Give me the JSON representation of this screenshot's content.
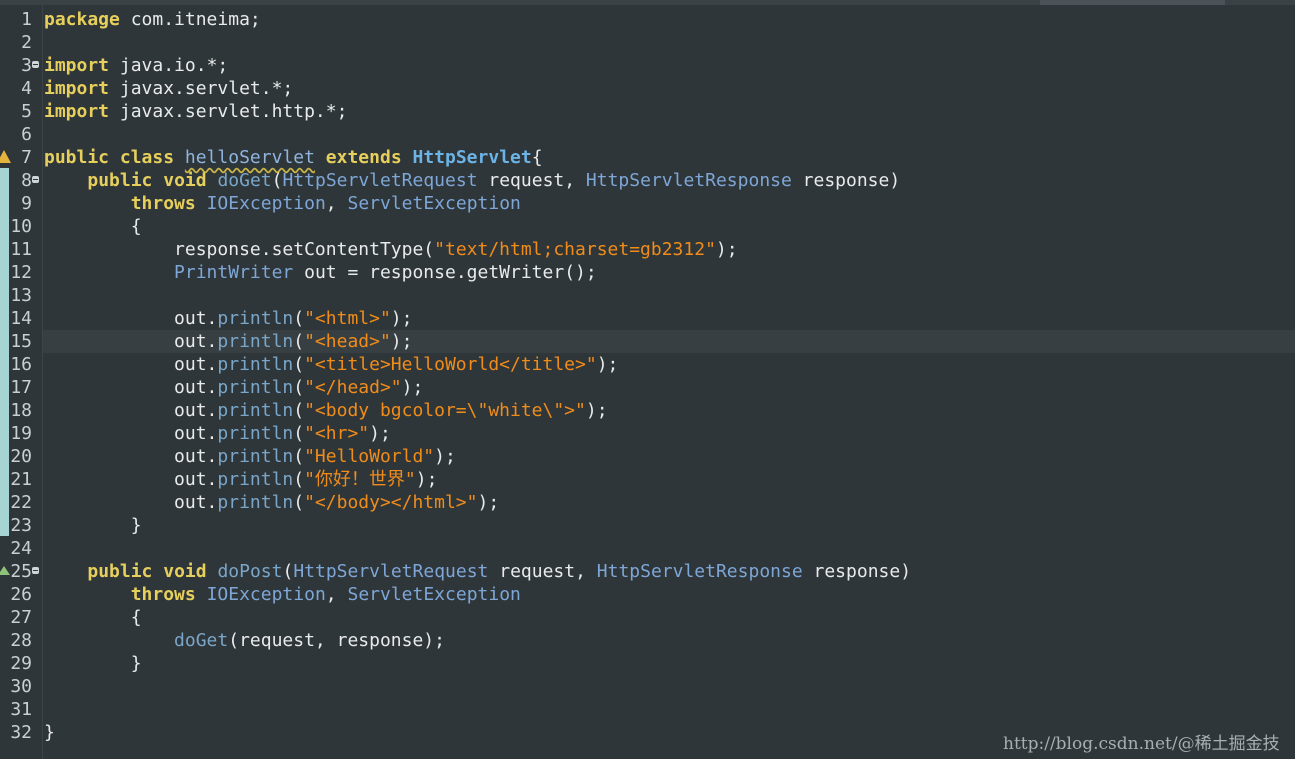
{
  "editor": {
    "language": "java",
    "lines": [
      {
        "n": "1",
        "tokens": [
          {
            "t": "package",
            "c": "kw"
          },
          {
            "t": " com.itneima;",
            "c": "pl"
          }
        ]
      },
      {
        "n": "2",
        "tokens": []
      },
      {
        "n": "3",
        "fold": true,
        "tokens": [
          {
            "t": "import",
            "c": "kw"
          },
          {
            "t": " java.io.*;",
            "c": "pl"
          }
        ]
      },
      {
        "n": "4",
        "tokens": [
          {
            "t": "import",
            "c": "kw"
          },
          {
            "t": " javax.servlet.*;",
            "c": "pl"
          }
        ]
      },
      {
        "n": "5",
        "tokens": [
          {
            "t": "import",
            "c": "kw"
          },
          {
            "t": " javax.servlet.http.*;",
            "c": "pl"
          }
        ]
      },
      {
        "n": "6",
        "tokens": []
      },
      {
        "n": "7",
        "marker": "warn",
        "tokens": [
          {
            "t": "public",
            "c": "kw"
          },
          {
            "t": " ",
            "c": "pl"
          },
          {
            "t": "class",
            "c": "kw"
          },
          {
            "t": " ",
            "c": "pl"
          },
          {
            "t": "helloServlet",
            "c": "cls"
          },
          {
            "t": " ",
            "c": "pl"
          },
          {
            "t": "extends",
            "c": "kw"
          },
          {
            "t": " ",
            "c": "pl"
          },
          {
            "t": "HttpServlet",
            "c": "tyb"
          },
          {
            "t": "{",
            "c": "pl"
          }
        ]
      },
      {
        "n": "8",
        "fold": true,
        "tokens": [
          {
            "t": "    ",
            "c": "pl"
          },
          {
            "t": "public",
            "c": "kw"
          },
          {
            "t": " ",
            "c": "pl"
          },
          {
            "t": "void",
            "c": "kw"
          },
          {
            "t": " ",
            "c": "pl"
          },
          {
            "t": "doGet",
            "c": "fn"
          },
          {
            "t": "(",
            "c": "pl"
          },
          {
            "t": "HttpServletRequest",
            "c": "ty"
          },
          {
            "t": " request, ",
            "c": "pl"
          },
          {
            "t": "HttpServletResponse",
            "c": "ty"
          },
          {
            "t": " response)",
            "c": "pl"
          }
        ]
      },
      {
        "n": "9",
        "tokens": [
          {
            "t": "        ",
            "c": "pl"
          },
          {
            "t": "throws",
            "c": "kw"
          },
          {
            "t": " ",
            "c": "pl"
          },
          {
            "t": "IOException",
            "c": "ty"
          },
          {
            "t": ", ",
            "c": "pl"
          },
          {
            "t": "ServletException",
            "c": "ty"
          }
        ]
      },
      {
        "n": "10",
        "tokens": [
          {
            "t": "        {",
            "c": "pl"
          }
        ]
      },
      {
        "n": "11",
        "tokens": [
          {
            "t": "            response.setContentType(",
            "c": "pl"
          },
          {
            "t": "\"text/html;charset=gb2312\"",
            "c": "str"
          },
          {
            "t": ");",
            "c": "pl"
          }
        ]
      },
      {
        "n": "12",
        "tokens": [
          {
            "t": "            ",
            "c": "pl"
          },
          {
            "t": "PrintWriter",
            "c": "ty"
          },
          {
            "t": " out = response.getWriter();",
            "c": "pl"
          }
        ]
      },
      {
        "n": "13",
        "tokens": []
      },
      {
        "n": "14",
        "tokens": [
          {
            "t": "            out.",
            "c": "pl"
          },
          {
            "t": "println",
            "c": "fn"
          },
          {
            "t": "(",
            "c": "pl"
          },
          {
            "t": "\"<html>\"",
            "c": "str"
          },
          {
            "t": ");",
            "c": "pl"
          }
        ]
      },
      {
        "n": "15",
        "current": true,
        "tokens": [
          {
            "t": "            out.",
            "c": "pl"
          },
          {
            "t": "println",
            "c": "fn"
          },
          {
            "t": "(",
            "c": "pl"
          },
          {
            "t": "\"<head>\"",
            "c": "str"
          },
          {
            "t": ");",
            "c": "pl"
          }
        ]
      },
      {
        "n": "16",
        "tokens": [
          {
            "t": "            out.",
            "c": "pl"
          },
          {
            "t": "println",
            "c": "fn"
          },
          {
            "t": "(",
            "c": "pl"
          },
          {
            "t": "\"<title>HelloWorld</title>\"",
            "c": "str"
          },
          {
            "t": ");",
            "c": "pl"
          }
        ]
      },
      {
        "n": "17",
        "tokens": [
          {
            "t": "            out.",
            "c": "pl"
          },
          {
            "t": "println",
            "c": "fn"
          },
          {
            "t": "(",
            "c": "pl"
          },
          {
            "t": "\"</head>\"",
            "c": "str"
          },
          {
            "t": ");",
            "c": "pl"
          }
        ]
      },
      {
        "n": "18",
        "tokens": [
          {
            "t": "            out.",
            "c": "pl"
          },
          {
            "t": "println",
            "c": "fn"
          },
          {
            "t": "(",
            "c": "pl"
          },
          {
            "t": "\"<body bgcolor=\\\"white\\\">\"",
            "c": "str"
          },
          {
            "t": ");",
            "c": "pl"
          }
        ]
      },
      {
        "n": "19",
        "tokens": [
          {
            "t": "            out.",
            "c": "pl"
          },
          {
            "t": "println",
            "c": "fn"
          },
          {
            "t": "(",
            "c": "pl"
          },
          {
            "t": "\"<hr>\"",
            "c": "str"
          },
          {
            "t": ");",
            "c": "pl"
          }
        ]
      },
      {
        "n": "20",
        "tokens": [
          {
            "t": "            out.",
            "c": "pl"
          },
          {
            "t": "println",
            "c": "fn"
          },
          {
            "t": "(",
            "c": "pl"
          },
          {
            "t": "\"HelloWorld\"",
            "c": "str"
          },
          {
            "t": ");",
            "c": "pl"
          }
        ]
      },
      {
        "n": "21",
        "tokens": [
          {
            "t": "            out.",
            "c": "pl"
          },
          {
            "t": "println",
            "c": "fn"
          },
          {
            "t": "(",
            "c": "pl"
          },
          {
            "t": "\"你好！世界\"",
            "c": "str"
          },
          {
            "t": ");",
            "c": "pl"
          }
        ]
      },
      {
        "n": "22",
        "tokens": [
          {
            "t": "            out.",
            "c": "pl"
          },
          {
            "t": "println",
            "c": "fn"
          },
          {
            "t": "(",
            "c": "pl"
          },
          {
            "t": "\"</body></html>\"",
            "c": "str"
          },
          {
            "t": ");",
            "c": "pl"
          }
        ]
      },
      {
        "n": "23",
        "tokens": [
          {
            "t": "        }",
            "c": "pl"
          }
        ]
      },
      {
        "n": "24",
        "tokens": []
      },
      {
        "n": "25",
        "fold": true,
        "marker": "override",
        "tokens": [
          {
            "t": "    ",
            "c": "pl"
          },
          {
            "t": "public",
            "c": "kw"
          },
          {
            "t": " ",
            "c": "pl"
          },
          {
            "t": "void",
            "c": "kw"
          },
          {
            "t": " ",
            "c": "pl"
          },
          {
            "t": "doPost",
            "c": "fn"
          },
          {
            "t": "(",
            "c": "pl"
          },
          {
            "t": "HttpServletRequest",
            "c": "ty"
          },
          {
            "t": " request, ",
            "c": "pl"
          },
          {
            "t": "HttpServletResponse",
            "c": "ty"
          },
          {
            "t": " response)",
            "c": "pl"
          }
        ]
      },
      {
        "n": "26",
        "tokens": [
          {
            "t": "        ",
            "c": "pl"
          },
          {
            "t": "throws",
            "c": "kw"
          },
          {
            "t": " ",
            "c": "pl"
          },
          {
            "t": "IOException",
            "c": "ty"
          },
          {
            "t": ", ",
            "c": "pl"
          },
          {
            "t": "ServletException",
            "c": "ty"
          }
        ]
      },
      {
        "n": "27",
        "tokens": [
          {
            "t": "        {",
            "c": "pl"
          }
        ]
      },
      {
        "n": "28",
        "tokens": [
          {
            "t": "            ",
            "c": "pl"
          },
          {
            "t": "doGet",
            "c": "fn"
          },
          {
            "t": "(request, response);",
            "c": "pl"
          }
        ]
      },
      {
        "n": "29",
        "tokens": [
          {
            "t": "        }",
            "c": "pl"
          }
        ]
      },
      {
        "n": "30",
        "tokens": []
      },
      {
        "n": "31",
        "tokens": []
      },
      {
        "n": "32",
        "tokens": [
          {
            "t": "}",
            "c": "pl"
          }
        ]
      }
    ]
  },
  "watermark": "http://blog.csdn.net/@稀土掘金技术社区",
  "colors": {
    "background": "#2f3639",
    "keyword": "#e6cf5c",
    "type": "#7ea6d6",
    "string": "#f08c1a",
    "plain": "#e8eaeb",
    "line_number": "#c9cfd2",
    "change_bar": "#a6d4d4"
  }
}
